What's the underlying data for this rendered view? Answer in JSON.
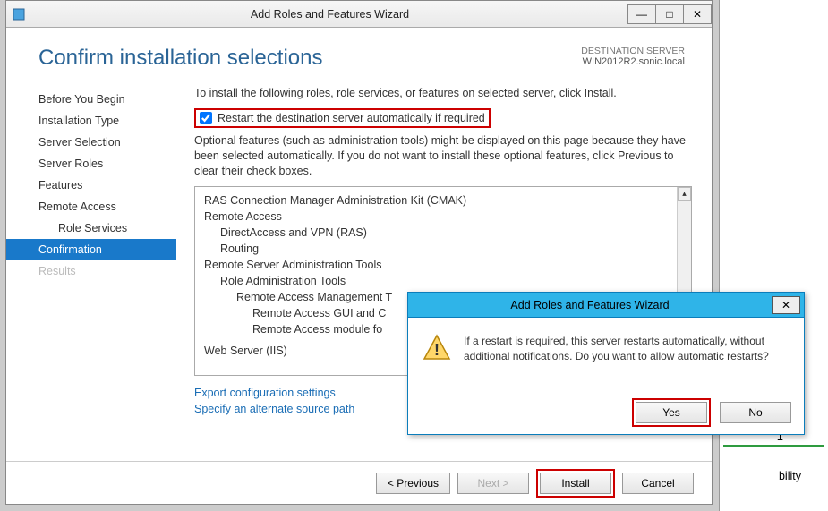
{
  "titlebar": {
    "title": "Add Roles and Features Wizard"
  },
  "header": {
    "page_title": "Confirm installation selections",
    "dest_label": "DESTINATION SERVER",
    "dest_value": "WIN2012R2.sonic.local"
  },
  "nav": {
    "items": [
      "Before You Begin",
      "Installation Type",
      "Server Selection",
      "Server Roles",
      "Features",
      "Remote Access"
    ],
    "sub_item": "Role Services",
    "selected": "Confirmation",
    "disabled": "Results"
  },
  "main": {
    "instruction": "To install the following roles, role services, or features on selected server, click Install.",
    "restart_label": "Restart the destination server automatically if required",
    "optional_text": "Optional features (such as administration tools) might be displayed on this page because they have been selected automatically. If you do not want to install these optional features, click Previous to clear their check boxes.",
    "tree": {
      "l0_0": "RAS Connection Manager Administration Kit (CMAK)",
      "l0_1": "Remote Access",
      "l1_0": "DirectAccess and VPN (RAS)",
      "l1_1": "Routing",
      "l0_2": "Remote Server Administration Tools",
      "l1_2": "Role Administration Tools",
      "l2_0": "Remote Access Management T",
      "l3_0": "Remote Access GUI and C",
      "l3_1": "Remote Access module fo",
      "l0_3": "Web Server (IIS)"
    },
    "links": {
      "export": "Export configuration settings",
      "alt_source": "Specify an alternate source path"
    }
  },
  "footer": {
    "previous": "< Previous",
    "next": "Next >",
    "install": "Install",
    "cancel": "Cancel"
  },
  "dialog": {
    "title": "Add Roles and Features Wizard",
    "message": "If a restart is required, this server restarts automatically, without additional notifications. Do you want to allow automatic restarts?",
    "yes": "Yes",
    "no": "No"
  },
  "rightstrip": {
    "num": "1",
    "text": "bility"
  }
}
